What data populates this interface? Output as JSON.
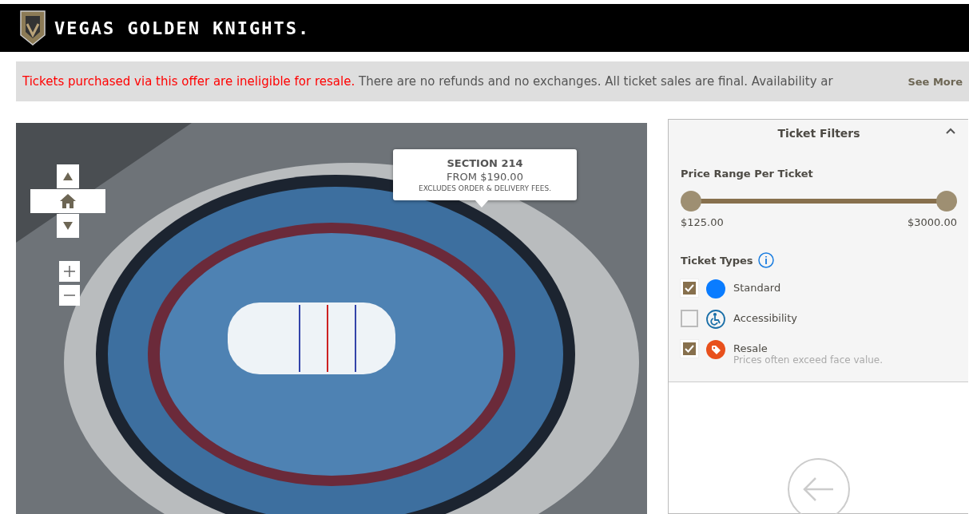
{
  "header": {
    "brand": "VEGAS GOLDEN KNIGHTS."
  },
  "notice": {
    "text": "**Tickets purchased via this offer are ineligible for resale.** There are no refunds and no exchanges. All ticket sales are final. Availability ar",
    "link": "See More"
  },
  "map": {
    "tooltip": {
      "section": "SECTION 214",
      "price": "FROM $190.00",
      "note": "EXCLUDES ORDER & DELIVERY FEES."
    }
  },
  "filters": {
    "title": "Ticket Filters",
    "expanded": true,
    "price_range": {
      "label": "Price Range Per Ticket",
      "min_label": "$125.00",
      "max_label": "$3000.00",
      "thumbs": [
        {
          "level": 0
        },
        {
          "level": 1
        }
      ]
    },
    "types_label": "Ticket Types",
    "types": [
      {
        "kind": "dot",
        "label": "Standard",
        "checked": true,
        "color": "#0a7cff"
      },
      {
        "kind": "wheelchair",
        "label": "Accessibility",
        "checked": false,
        "color": "#1a6fa8"
      },
      {
        "kind": "tag",
        "label": "Resale",
        "note": "Prices often exceed face value.",
        "checked": true,
        "color": "#e8501c"
      }
    ]
  }
}
